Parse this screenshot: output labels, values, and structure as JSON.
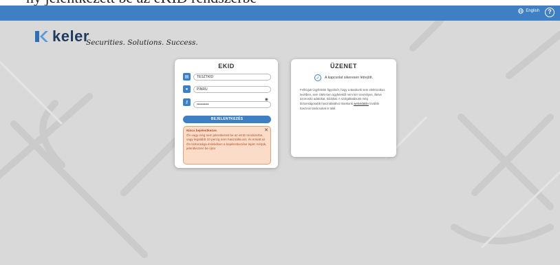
{
  "cutoff_text": "ny jelentkezett be az eKID rendszerbe",
  "topbar": {
    "language_label": "English",
    "help_label": "?"
  },
  "logo": {
    "name": "keler",
    "tagline": "Securities. Solutions. Success."
  },
  "login": {
    "title": "EKID",
    "username": "TESZTKID",
    "pin": "PINRU",
    "password_mask": "••••••••••",
    "button": "BEJELENTKEZÉS",
    "alert": {
      "title": "Nincs bejelentkezve.",
      "text": "Ön vagy még nem jelentkezett be az eKID rendszerbe, vagy legalább 10 percig nem használta azt, és emiatt az Ön biztonsága érdekében a bejelentkezése lejárt. Kérjük, jelentkezzen be újra!"
    }
  },
  "message": {
    "title": "ÜZENET",
    "status": "A kapcsolat sikeresen létrejött.",
    "body_part1": "Felhívjuk Ügyfeleink figyelmét, hogy a Bankunk sem elektronikus levélben, sem SMS-ben ügyfelektől nem kér személyes, illetve azonosító adatokat, kódokat. A szolgáltatásunk még biztonságosabb használatához Bankunk ",
    "body_link": "weboldalán",
    "body_part2": " további hasznos tanácsokat is talál."
  },
  "colors": {
    "accent": "#3f80c4",
    "background": "#d9d9d9",
    "alert_bg": "#fbdcc8",
    "alert_text": "#b24d22"
  }
}
